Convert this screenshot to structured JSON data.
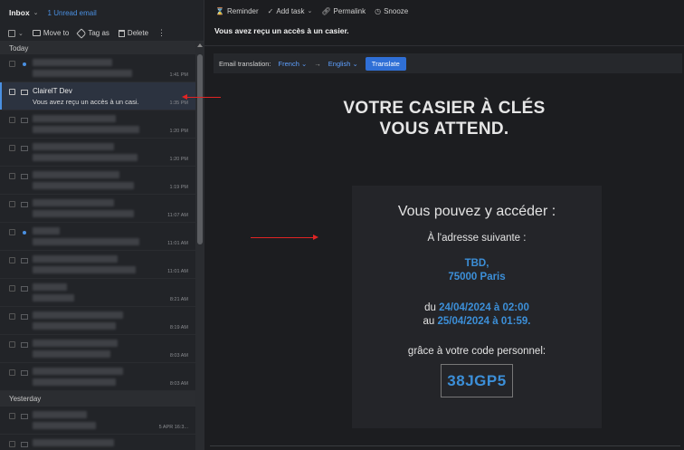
{
  "header": {
    "inbox_label": "Inbox",
    "unread_label": "1 Unread email"
  },
  "toolbar": {
    "move_to": "Move to",
    "tag_as": "Tag as",
    "delete": "Delete"
  },
  "groups": {
    "today": "Today",
    "yesterday": "Yesterday"
  },
  "messages": [
    {
      "time": "1:41 PM"
    },
    {
      "sender": "ClairelT Dev",
      "subject": "Vous avez reçu un accès à un casi...",
      "time": "1:35 PM"
    },
    {
      "time": "1:20 PM"
    },
    {
      "time": "1:20 PM"
    },
    {
      "time": "1:19 PM"
    },
    {
      "time": "11:07 AM"
    },
    {
      "time": "11:01 AM"
    },
    {
      "time": "11:01 AM"
    },
    {
      "time": "8:21 AM"
    },
    {
      "time": "8:19 AM"
    },
    {
      "time": "8:03 AM"
    },
    {
      "time": "8:03 AM"
    },
    {
      "time": "5 APR 16:3..."
    }
  ],
  "mail_actions": {
    "reminder": "Reminder",
    "add_task": "Add task",
    "permalink": "Permalink",
    "snooze": "Snooze"
  },
  "mail": {
    "subject": "Vous avez reçu un accès à un casier.",
    "translation_label": "Email translation:",
    "from_lang": "French",
    "to_lang": "English",
    "translate_button": "Translate",
    "hero_line1": "VOTRE CASIER À CLÉS",
    "hero_line2": "VOUS ATTEND.",
    "access": "Vous pouvez y accéder :",
    "address_label": "À l'adresse suivante :",
    "address_line1": "TBD,",
    "address_line2": "75000 Paris",
    "from_prefix": "du",
    "from_date": "24/04/2024 à 02:00",
    "to_prefix": "au",
    "to_date": "25/04/2024 à 01:59.",
    "code_label": "grâce à votre code personnel:",
    "code": "38JGP5"
  },
  "colors": {
    "accent": "#4a90e2",
    "link_blue": "#3c8fd8",
    "annotation_red": "#e02424"
  }
}
